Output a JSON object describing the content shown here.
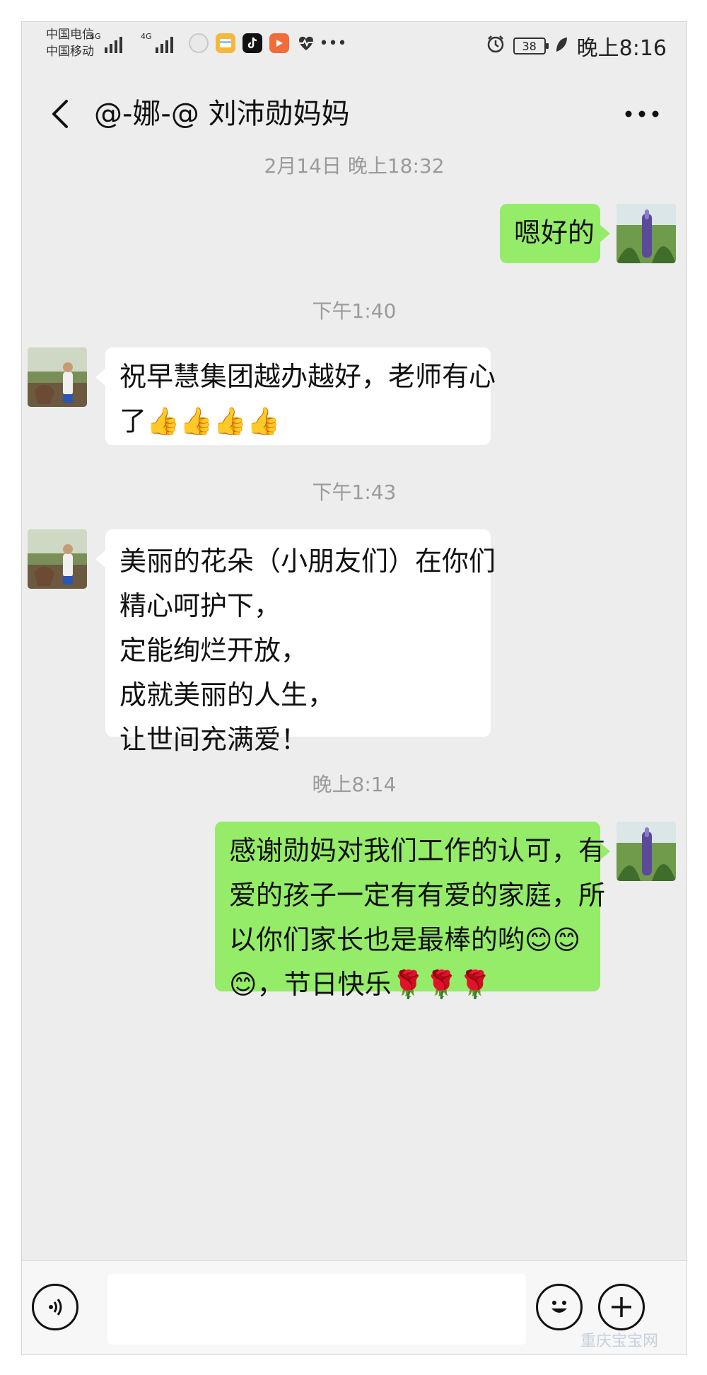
{
  "status_bar": {
    "carrier_1": "中国电信",
    "carrier_2": "中国移动",
    "network_1": "4G",
    "network_2": "4G",
    "battery": "38",
    "time": "晚上8:16",
    "icons": [
      "alarm-icon",
      "battery-icon",
      "leaf-icon"
    ],
    "app_icons": [
      "notification-circle-icon",
      "wallet-card-icon",
      "tiktok-icon",
      "video-app-icon",
      "health-heart-icon",
      "more-dots-icon"
    ]
  },
  "header": {
    "back_icon": "chevron-left-icon",
    "title": "@-娜-@   刘沛勋妈妈",
    "more_icon": "more-dots-icon"
  },
  "messages": [
    {
      "type": "time",
      "text": "2月14日 晚上18:32"
    },
    {
      "type": "out",
      "lines": [
        "嗯好的"
      ]
    },
    {
      "type": "time",
      "text": "下午1:40"
    },
    {
      "type": "in",
      "lines": [
        "祝早慧集团越办越好，老师有心",
        "了👍👍👍👍"
      ]
    },
    {
      "type": "time",
      "text": "下午1:43"
    },
    {
      "type": "in",
      "lines": [
        "美丽的花朵（小朋友们）在你们",
        "精心呵护下，",
        "定能绚烂开放，",
        "成就美丽的人生，",
        "让世间充满爱！"
      ]
    },
    {
      "type": "time",
      "text": "晚上8:14"
    },
    {
      "type": "out",
      "lines": [
        "感谢勋妈对我们工作的认可，有",
        "爱的孩子一定有有爱的家庭，所",
        "以你们家长也是最棒的哟😊😊",
        "😊，节日快乐🌹🌹🌹"
      ]
    }
  ],
  "input_bar": {
    "voice_icon": "voice-icon",
    "emoji_icon": "emoji-smile-icon",
    "plus_icon": "plus-icon",
    "text": ""
  },
  "watermark": "重庆宝宝网",
  "colors": {
    "chat_background": "#ededed",
    "outgoing_bubble": "#95ec69",
    "incoming_bubble": "#ffffff",
    "timestamp_text": "#9a9a9a"
  }
}
